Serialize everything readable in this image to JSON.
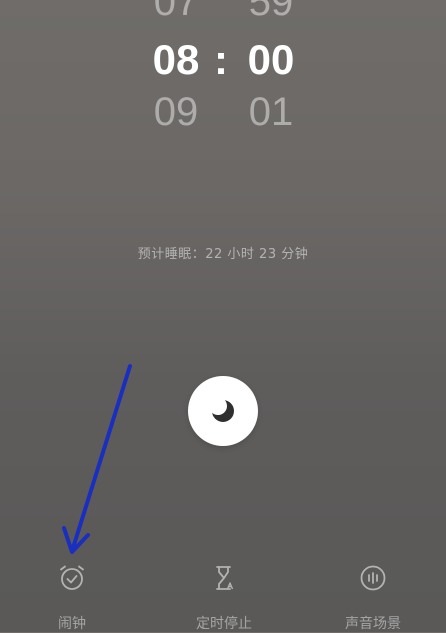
{
  "time_picker": {
    "hours": {
      "prev": "07",
      "current": "08",
      "next": "09"
    },
    "separator": ":",
    "minutes": {
      "prev": "59",
      "current": "00",
      "next": "01"
    }
  },
  "sleep_estimate": "预计睡眠：22 小时 23 分钟",
  "start_button": {
    "icon": "moon-icon"
  },
  "tabs": [
    {
      "label": "闹钟",
      "icon": "alarm-clock-icon"
    },
    {
      "label": "定时停止",
      "icon": "hourglass-icon"
    },
    {
      "label": "声音场景",
      "icon": "sound-wave-icon"
    }
  ],
  "colors": {
    "annotation_arrow": "#1a2fbf",
    "tab_label": "#b4b3b2",
    "moon": "#2f2f2f"
  }
}
